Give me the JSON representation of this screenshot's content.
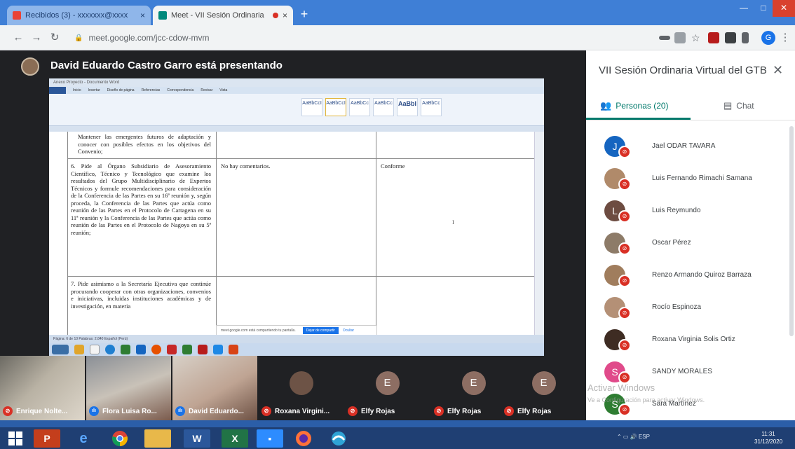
{
  "browser": {
    "tabs": [
      {
        "label": "Recibidos (3) - xxxxxxx@xxxx",
        "active": false
      },
      {
        "label": "Meet - VII Sesión Ordinaria",
        "active": true
      }
    ],
    "new_tab": "+",
    "close": "×",
    "url": "meet.google.com/jcc-cdow-mvm",
    "profile_initial": "G"
  },
  "meet": {
    "presenter_text": "David Eduardo Castro Garro está presentando",
    "document": {
      "window_title": "Anexo Proyecto - Documento Word",
      "ribbon_tabs": [
        "Inicio",
        "Insertar",
        "Diseño de página",
        "Referencias",
        "Correspondencia",
        "Revisar",
        "Vista"
      ],
      "styles": [
        "AaBbCcI",
        "AaBbCcI",
        "AaBbCc",
        "AaBbCc",
        "AaBbI",
        "AaBbCc"
      ],
      "row5_col1": "Mantener las emergentes futuros de adaptación y conocer con posibles efectos en los objetivos del Convenio;",
      "row6_col1": "6.  Pide al Órgano Subsidiario de Asesoramiento Científico, Técnico y Tecnológico que examine los resultados del Grupo Multidisciplinario de Expertos Técnicos y formule recomendaciones para consideración de la Conferencia de las Partes en su 16ª reunión y, según proceda, la Conferencia de las Partes que actúa como reunión de las Partes en el Protocolo de Cartagena en su 11ª reunión y la Conferencia de las Partes que actúa como reunión de las Partes en el Protocolo de Nagoya en su 5ª reunión;",
      "row6_col2": "No hay comentarios.",
      "row6_col3": "Conforme",
      "row7_col1": "7.  Pide asimismo a la Secretaría Ejecutiva que continúe procurando cooperar con otras organizaciones, convenios e iniciativas, incluidas instituciones académicas y de investigación, en materia",
      "cursor": "I",
      "status": "Página: 6 de 10   Palabras: 2.840   Español (Perú)",
      "share_notice": "meet.google.com está compartiendo tu pantalla.",
      "stop_label": "Dejar de compartir",
      "hide_label": "Ocultar"
    },
    "tiles": [
      {
        "name": "Enrique Nolte...",
        "muted": true
      },
      {
        "name": "Flora Luisa Ro...",
        "muted": false
      },
      {
        "name": "David Eduardo...",
        "muted": false
      },
      {
        "name": "Roxana Virgini...",
        "muted": true
      },
      {
        "name": "Elfy Rojas",
        "muted": true,
        "initial": "E"
      },
      {
        "name": "Elfy Rojas",
        "muted": true,
        "initial": "E"
      },
      {
        "name": "Elfy Rojas",
        "muted": true,
        "initial": "E"
      }
    ]
  },
  "panel": {
    "title": "VII Sesión Ordinaria Virtual del GTB",
    "close": "✕",
    "tab_people": "Personas (20)",
    "tab_chat": "Chat",
    "people": [
      {
        "name": "Jael ODAR TAVARA",
        "initial": "J",
        "color": "#1565c0"
      },
      {
        "name": "Luis Fernando Rimachi Samana",
        "initial": "",
        "color": "#b08a6a"
      },
      {
        "name": "Luis Reymundo",
        "initial": "L",
        "color": "#6d4c41"
      },
      {
        "name": "Oscar Pérez",
        "initial": "",
        "color": "#8d7b68"
      },
      {
        "name": "Renzo Armando Quiroz Barraza",
        "initial": "",
        "color": "#a07d5d"
      },
      {
        "name": "Rocío Espinoza",
        "initial": "",
        "color": "#b49076"
      },
      {
        "name": "Roxana Virginia Solis Ortiz",
        "initial": "",
        "color": "#3e2c23"
      },
      {
        "name": "SANDY MORALES",
        "initial": "S",
        "color": "#e04a8a"
      },
      {
        "name": "Sara Martínez",
        "initial": "S",
        "color": "#2e7d32"
      }
    ],
    "watermark_line1": "Activar Windows",
    "watermark_line2": "Ve a Configuración para activar Windows."
  },
  "taskbar": {
    "clock_time": "11:31",
    "clock_date": "31/12/2020"
  }
}
